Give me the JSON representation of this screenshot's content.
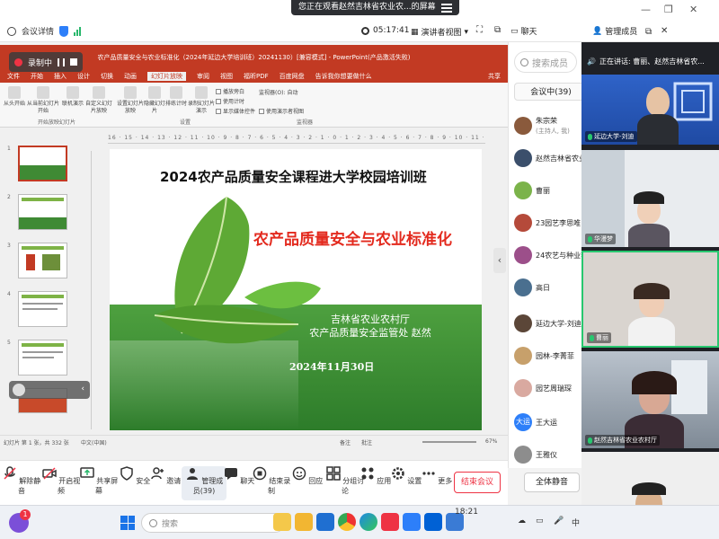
{
  "window": {
    "share_tip": "您正在观看赵然吉林省农业农...的屏幕",
    "meeting_details": "会议详情",
    "timer": "05:17:41",
    "view_mode": "演讲者视图",
    "chat_tab": "聊天",
    "members_tab": "管理成员"
  },
  "ppt": {
    "title_bar": "农产品质量安全与农业标准化（2024年延边大学培训班）20241130）[兼容模式] - PowerPoint(产品激活失败)",
    "recording_label": "录制中",
    "tabs": [
      "文件",
      "开始",
      "插入",
      "设计",
      "切换",
      "动画",
      "幻灯片放映",
      "审阅",
      "视图",
      "福昕PDF",
      "百度网盘"
    ],
    "active_tab": "幻灯片放映",
    "tell_me": "告诉我你想要做什么",
    "share_btn": "共享",
    "ribbon": {
      "from_start": "从头开始",
      "from_current": "从当前幻灯片开始",
      "online": "联机演示",
      "custom": "自定义幻灯片放映",
      "setup": "设置幻灯片放映",
      "hide": "隐藏幻灯片",
      "rehearse": "排练计时",
      "record": "录制幻灯片演示",
      "play_narration": "播放旁白",
      "use_timing": "使用计时",
      "show_media": "显示媒体控件",
      "monitor": "监视器(O):",
      "monitor_value": "自动",
      "presenter_view": "使用演示者视图",
      "group_start": "开始放映幻灯片",
      "group_setup": "设置",
      "group_monitor": "监视器"
    },
    "ruler": "16 · 15 · 14 · 13 · 12 · 11 · 10 · 9 · 8 · 7 · 6 · 5 · 4 · 3 · 2 · 1 · 0 · 1 · 2 · 3 · 4 · 5 · 6 · 7 · 8 · 9 · 10 · 11 · 12 · 13 · 14 · 15 · 16",
    "thumb_numbers": [
      "1",
      "2",
      "3",
      "4",
      "5"
    ],
    "status": {
      "slide_of": "幻灯片 第 1 张，共 332 张",
      "lang": "中文(中国)",
      "notes": "备注",
      "comments": "批注",
      "zoom": "67%"
    }
  },
  "slide": {
    "title": "2024农产品质量安全课程进大学校园培训班",
    "subtitle": "农产品质量安全与农业标准化",
    "org_line1": "吉林省农业农村厅",
    "org_line2": "农产品质量安全监管处  赵然",
    "date": "2024年11月30日"
  },
  "panel": {
    "search_placeholder": "搜索成员",
    "meeting_count": "会议中(39)",
    "participants": [
      {
        "name": "朱宗荣",
        "note": "(主持人, 我)",
        "color": "#8a5a3c"
      },
      {
        "name": "赵然吉林省农业农村厅",
        "note": "",
        "color": "#3b4f6b"
      },
      {
        "name": "曹丽",
        "note": "",
        "color": "#7bb34a"
      },
      {
        "name": "23园艺李思唯",
        "note": "",
        "color": "#b54a3a"
      },
      {
        "name": "24农艺与种业李静",
        "note": "",
        "color": "#9c4f8a"
      },
      {
        "name": "高日",
        "note": "",
        "color": "#4a6f8f"
      },
      {
        "name": "延边大学-刘迪",
        "note": "",
        "color": "#5b4638"
      },
      {
        "name": "园林-李菁菲",
        "note": "",
        "color": "#c7a06b"
      },
      {
        "name": "园艺周瑞琛",
        "note": "",
        "color": "#d9a9a0"
      },
      {
        "name": "王大运",
        "note": "",
        "avatar_text": "大运",
        "color": "#2d7ff9"
      },
      {
        "name": "王雅仪",
        "note": "",
        "color": "#8d8d8d"
      }
    ],
    "mute_all": "全体静音"
  },
  "videos": {
    "speaking": "正在讲话: 曹丽、赵然吉林省农...",
    "tiles": [
      {
        "label": "延边大学-刘迪"
      },
      {
        "label": "华漫梦"
      },
      {
        "label": "曹丽"
      },
      {
        "label": "赵然吉林省农业农村厅"
      },
      {
        "label": ""
      }
    ]
  },
  "toolbar": {
    "buttons": [
      "解除静音",
      "开启视频",
      "共享屏幕",
      "安全",
      "邀请",
      "管理成员(39)",
      "聊天",
      "结束录制",
      "回应",
      "分组讨论",
      "应用",
      "设置",
      "更多"
    ],
    "end_meeting": "结束会议",
    "taskbar_time": "18:21"
  },
  "taskbar": {
    "search_placeholder": "搜索",
    "badge": "1",
    "ime": "中"
  }
}
